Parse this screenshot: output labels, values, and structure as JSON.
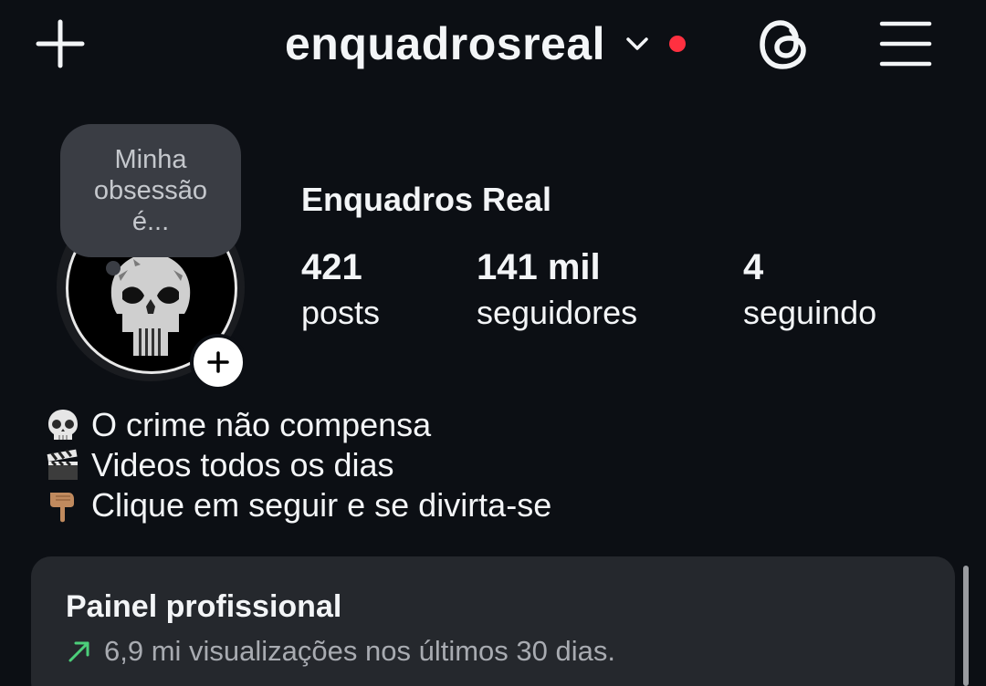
{
  "header": {
    "username": "enquadrosreal",
    "icons": {
      "create": "plus-icon",
      "account_switch": "chevron-down-icon",
      "notification": "red-dot",
      "threads": "threads-icon",
      "menu": "hamburger-menu-icon"
    },
    "notification_color": "#ff3040"
  },
  "note": {
    "text": "Minha obsessão é..."
  },
  "profile": {
    "display_name": "Enquadros Real",
    "stats": [
      {
        "value": "421",
        "label": "posts"
      },
      {
        "value": "141 mil",
        "label": "seguidores"
      },
      {
        "value": "4",
        "label": "seguindo"
      }
    ]
  },
  "bio": {
    "lines": [
      {
        "icon": "skull-emoji",
        "text": "O crime não compensa"
      },
      {
        "icon": "clapper-board-emoji",
        "text": "Videos todos os dias"
      },
      {
        "icon": "pointing-down-hand-emoji",
        "text": "Clique em seguir e se divirta-se"
      }
    ]
  },
  "dashboard": {
    "title": "Painel profissional",
    "subtitle": "6,9 mi visualizações nos últimos 30 dias.",
    "trend_icon": "trend-up-arrow-icon",
    "trend_color": "#4ccf7a"
  }
}
